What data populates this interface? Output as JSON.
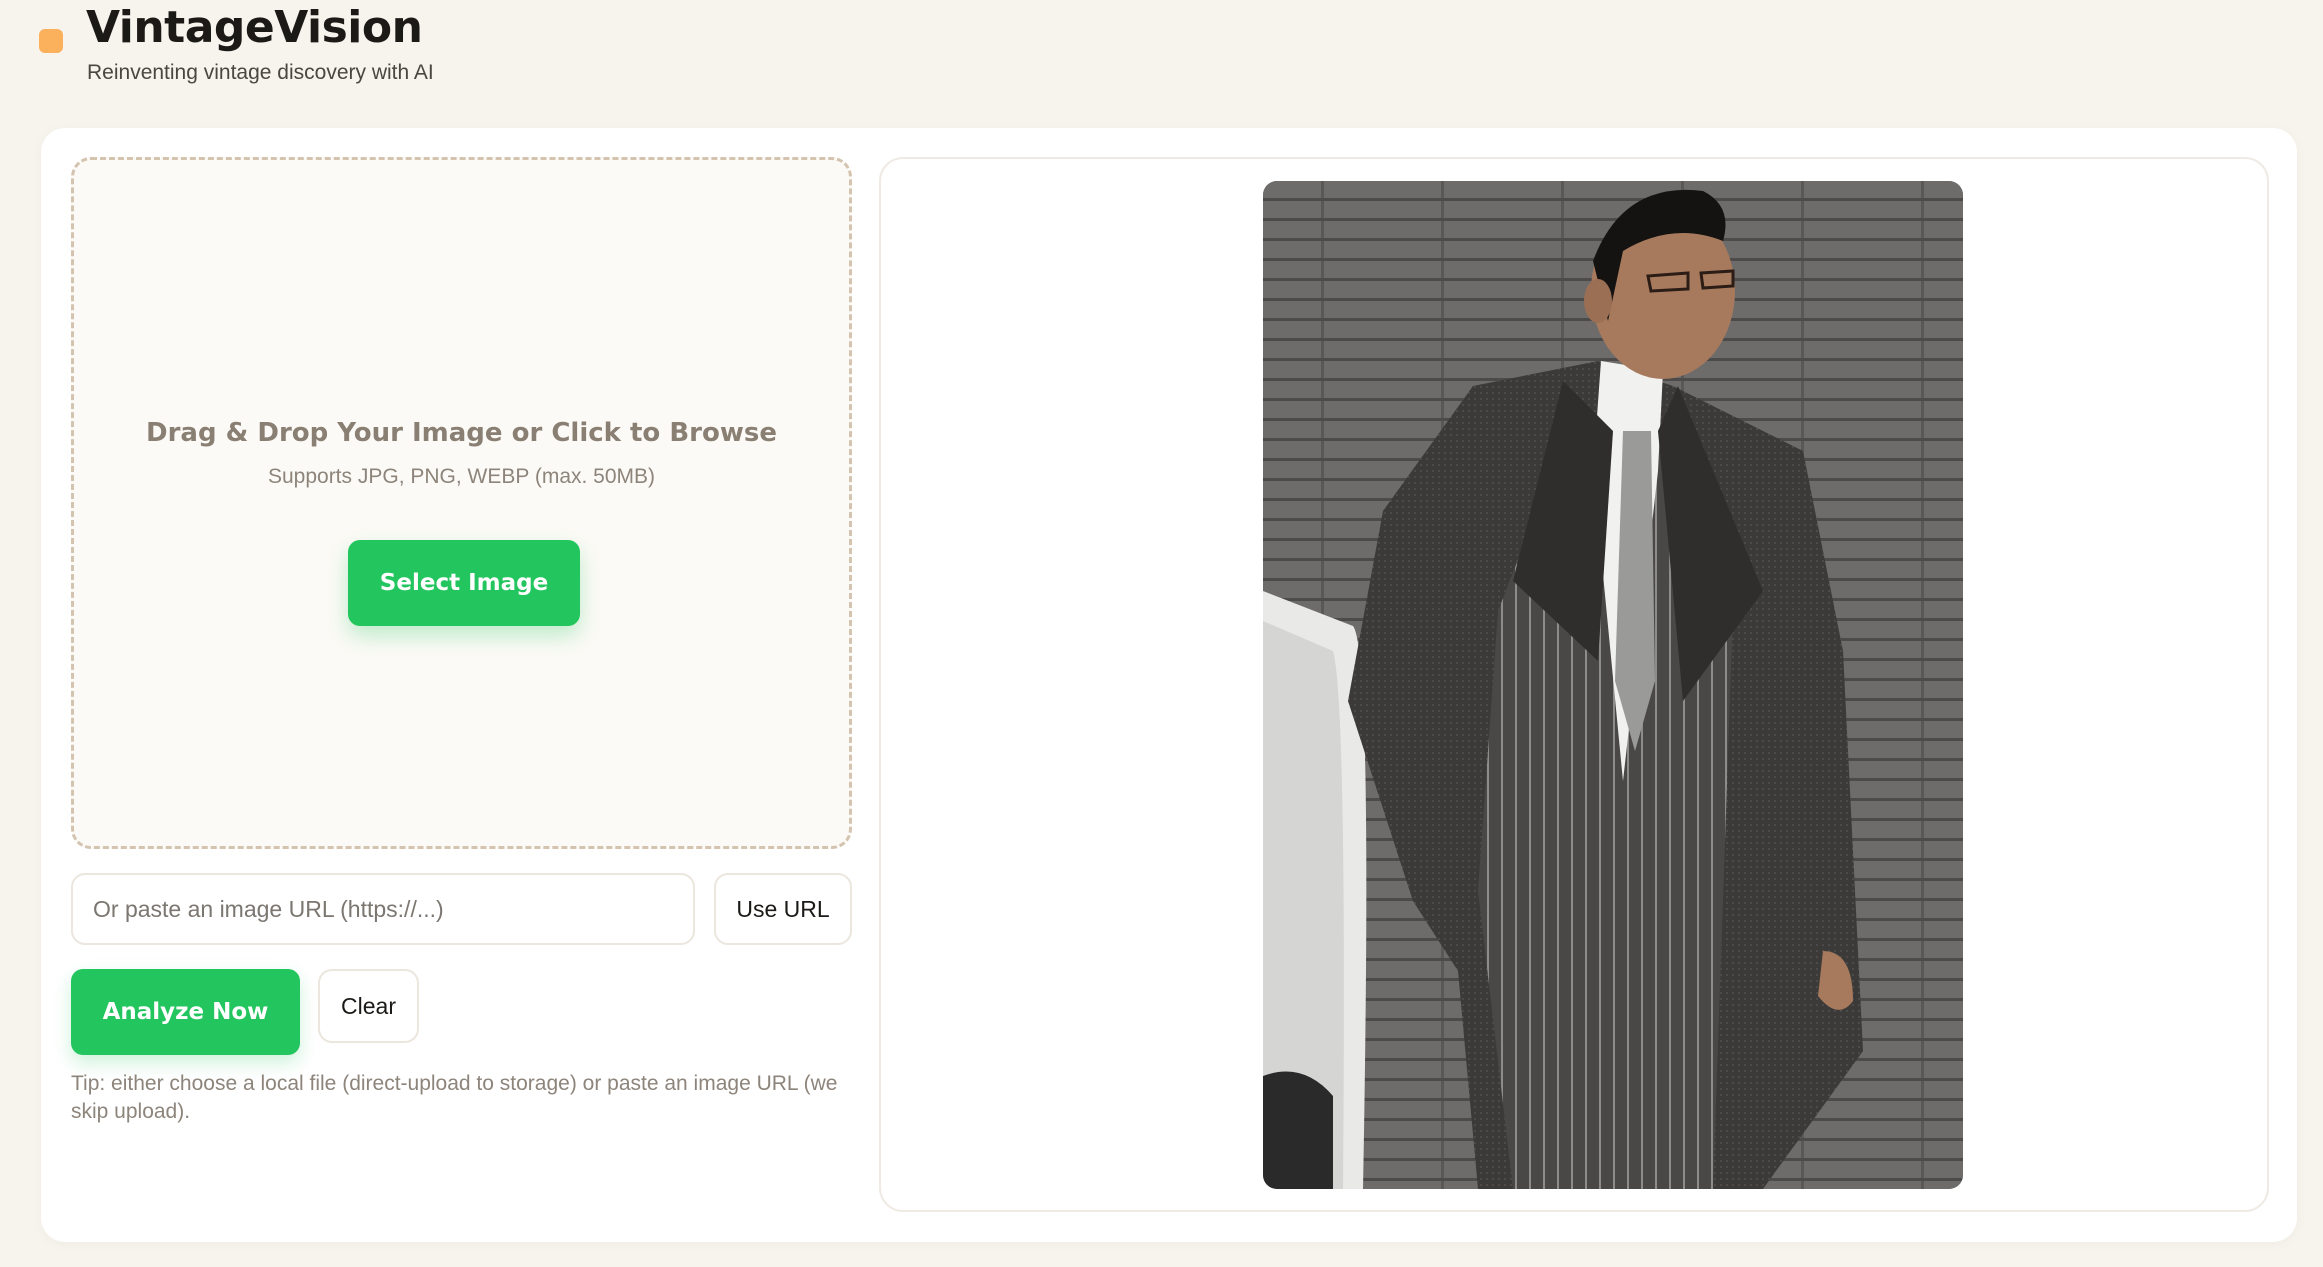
{
  "header": {
    "title": "VintageVision",
    "subtitle": "Reinventing vintage discovery with AI",
    "logo_icon": "rounded-square-logo-icon"
  },
  "upload": {
    "title": "Drag & Drop Your Image or Click to Browse",
    "hint": "Supports JPG, PNG, WEBP (max. 50MB)",
    "select_label": "Select Image"
  },
  "url": {
    "placeholder": "Or paste an image URL (https://...)",
    "value": "",
    "use_label": "Use URL"
  },
  "actions": {
    "analyze_label": "Analyze Now",
    "clear_label": "Clear"
  },
  "tip": "Tip: either choose a local file (direct-upload to storage) or paste an image URL (we skip upload).",
  "preview": {
    "image_subject": "elderly man in grey pinstripe suit and overcoat leaning against a white car in front of a brick wall"
  },
  "colors": {
    "background": "#f7f4ee",
    "accent_orange": "#fbb05c",
    "accent_green": "#22c55e",
    "dropzone_border": "#d4c3ae"
  }
}
